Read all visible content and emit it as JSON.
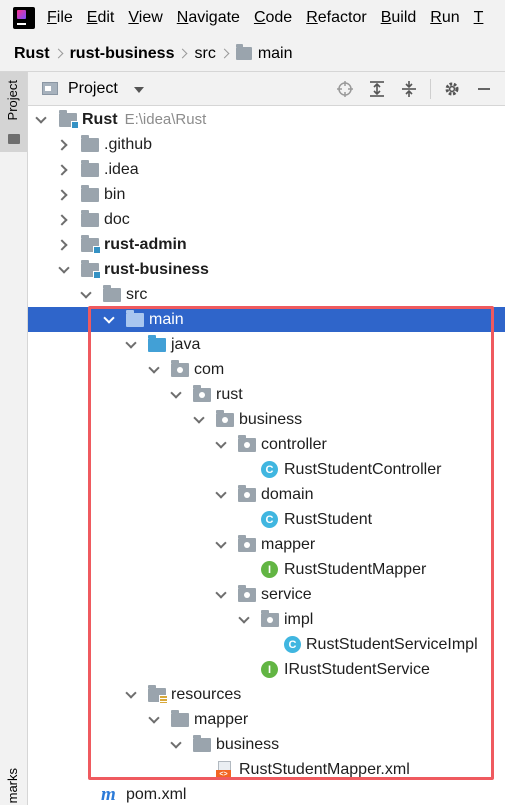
{
  "menubar": {
    "app_icon": "intellij-idea-logo",
    "items": [
      {
        "mnemonic": "F",
        "rest": "ile"
      },
      {
        "mnemonic": "E",
        "rest": "dit"
      },
      {
        "mnemonic": "V",
        "rest": "iew"
      },
      {
        "mnemonic": "N",
        "rest": "avigate"
      },
      {
        "mnemonic": "C",
        "rest": "ode"
      },
      {
        "mnemonic": "R",
        "rest": "efactor"
      },
      {
        "mnemonic": "B",
        "rest": "uild"
      },
      {
        "mnemonic": "R",
        "rest": "un"
      },
      {
        "mnemonic": "T",
        "rest": ""
      }
    ]
  },
  "breadcrumb": {
    "items": [
      "Rust",
      "rust-business",
      "src",
      "main"
    ]
  },
  "side_strip": {
    "project_tab": "Project",
    "bottom_tab": "marks"
  },
  "panel": {
    "title": "Project",
    "tools": [
      "locate-icon",
      "expand-all-icon",
      "collapse-all-icon",
      "gear-icon",
      "minimize-icon"
    ]
  },
  "tree": {
    "root": {
      "name": "Rust",
      "hint": "E:\\idea\\Rust"
    },
    "github": ".github",
    "idea": ".idea",
    "bin": "bin",
    "doc": "doc",
    "rust_admin": "rust-admin",
    "rust_business": "rust-business",
    "src": "src",
    "main": "main",
    "java": "java",
    "com": "com",
    "rust": "rust",
    "business": "business",
    "controller": "controller",
    "controller_class": "RustStudentController",
    "domain": "domain",
    "domain_class": "RustStudent",
    "mapper": "mapper",
    "mapper_interface": "RustStudentMapper",
    "service": "service",
    "impl": "impl",
    "impl_class": "RustStudentServiceImpl",
    "service_interface": "IRustStudentService",
    "resources": "resources",
    "res_mapper": "mapper",
    "res_business": "business",
    "xml_file": "RustStudentMapper.xml",
    "pom": "pom.xml",
    "class_glyph": "C",
    "interface_glyph": "I",
    "maven_glyph": "m",
    "xml_glyph": "<>"
  },
  "highlight_color": "#ef5a5f",
  "selection_color": "#2f65ca"
}
